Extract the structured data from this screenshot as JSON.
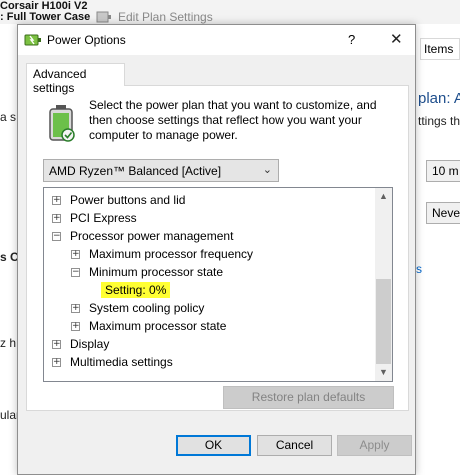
{
  "background": {
    "top_line_1": "Corsair H100i V2",
    "top_line_2": ": Full Tower Case",
    "edit_plan_title": "Edit Plan Settings",
    "left_fragments": [
      "a s",
      "s C",
      "z h",
      "ular"
    ],
    "right_tab": "Items",
    "right_heading": "plan: A",
    "right_text": "ttings th",
    "right_combo_1": "10 m",
    "right_combo_2": "Neve",
    "right_link": "s"
  },
  "dialog": {
    "title": "Power Options",
    "help_label": "?",
    "close_label": "✕",
    "tab_label": "Advanced settings",
    "description": "Select the power plan that you want to customize, and then choose settings that reflect how you want your computer to manage power.",
    "plan_selected": "AMD Ryzen™ Balanced [Active]",
    "tree": [
      {
        "label": "Power buttons and lid",
        "expander": "+"
      },
      {
        "label": "PCI Express",
        "expander": "+"
      },
      {
        "label": "Processor power management",
        "expander": "−"
      },
      {
        "label": "Maximum processor frequency",
        "expander": "+"
      },
      {
        "label": "Minimum processor state",
        "expander": "−"
      },
      {
        "label": "Setting:",
        "value": "0%"
      },
      {
        "label": "System cooling policy",
        "expander": "+"
      },
      {
        "label": "Maximum processor state",
        "expander": "+"
      },
      {
        "label": "Display",
        "expander": "+"
      },
      {
        "label": "Multimedia settings",
        "expander": "+"
      }
    ],
    "restore_label": "Restore plan defaults",
    "ok_label": "OK",
    "cancel_label": "Cancel",
    "apply_label": "Apply"
  },
  "icons": {
    "title_icon": "power-options-icon",
    "battery_icon": "battery-icon",
    "scroll_up": "scroll-up-arrow-icon",
    "scroll_down": "scroll-down-arrow-icon",
    "combo_chevron": "chevron-down-icon"
  },
  "colors": {
    "highlight": "#ffff33",
    "ok_border": "#0078d7",
    "link": "#0066cc"
  }
}
